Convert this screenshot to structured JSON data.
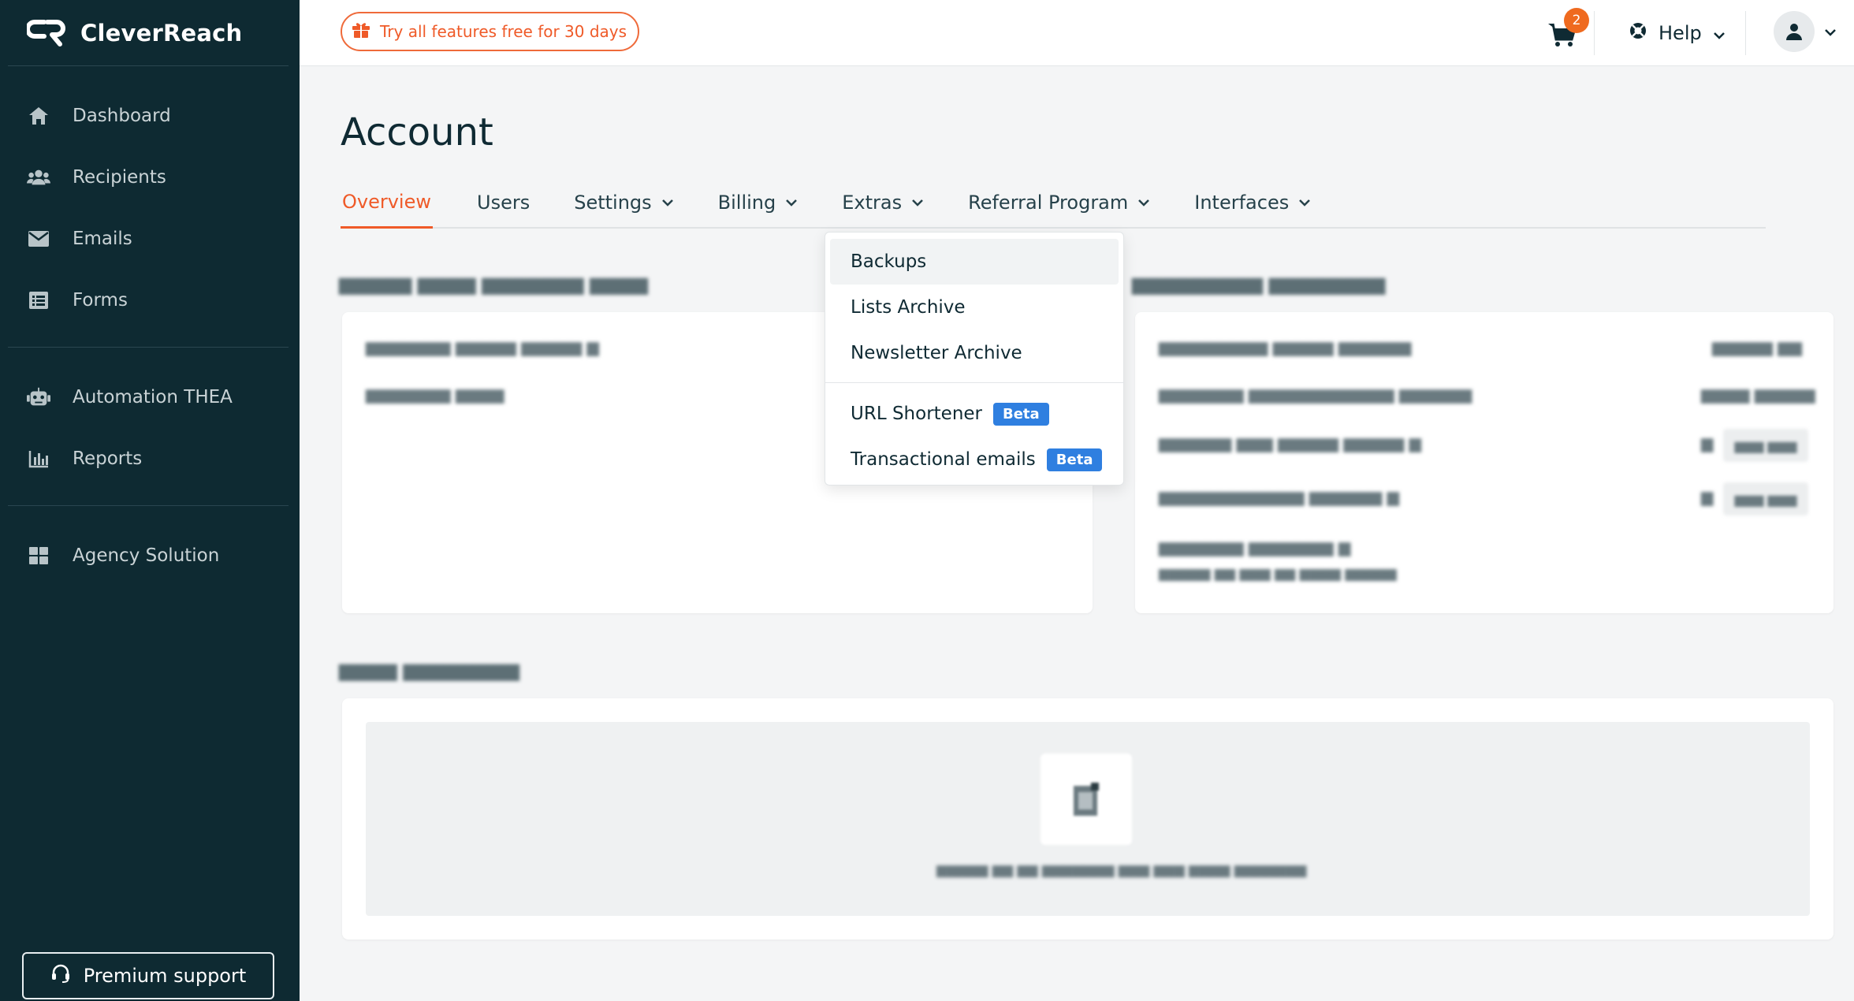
{
  "brand": {
    "name": "CleverReach"
  },
  "sidebar": {
    "items": [
      {
        "label": "Dashboard",
        "icon": "home-icon"
      },
      {
        "label": "Recipients",
        "icon": "users-icon"
      },
      {
        "label": "Emails",
        "icon": "envelope-icon"
      },
      {
        "label": "Forms",
        "icon": "form-icon"
      },
      {
        "label": "Automation THEA",
        "icon": "robot-icon"
      },
      {
        "label": "Reports",
        "icon": "chart-icon"
      },
      {
        "label": "Agency Solution",
        "icon": "grid-icon"
      }
    ],
    "premium_support": "Premium support"
  },
  "topbar": {
    "trial_label": "Try all features free for 30 days",
    "cart_count": "2",
    "help_label": "Help"
  },
  "page": {
    "title": "Account",
    "tabs": [
      {
        "label": "Overview",
        "active": true
      },
      {
        "label": "Users"
      },
      {
        "label": "Settings"
      },
      {
        "label": "Billing"
      },
      {
        "label": "Extras"
      },
      {
        "label": "Referral Program"
      },
      {
        "label": "Interfaces"
      }
    ]
  },
  "extras_menu": {
    "items": [
      {
        "label": "Backups"
      },
      {
        "label": "Lists Archive"
      },
      {
        "label": "Newsletter Archive"
      },
      {
        "label": "URL Shortener",
        "badge": "Beta"
      },
      {
        "label": "Transactional emails",
        "badge": "Beta"
      }
    ]
  },
  "colors": {
    "accent": "#ef5a28",
    "sidebar_bg": "#0e2a32",
    "beta_badge": "#2f7fe0",
    "cart_badge": "#ef6a1f"
  }
}
